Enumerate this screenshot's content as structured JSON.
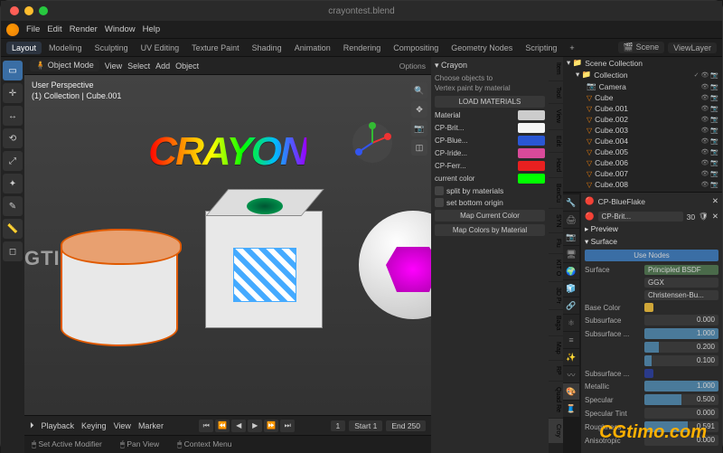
{
  "window": {
    "title": "crayontest.blend"
  },
  "menubar": [
    "File",
    "Edit",
    "Render",
    "Window",
    "Help"
  ],
  "workspaces": {
    "tabs": [
      "Layout",
      "Modeling",
      "Sculpting",
      "UV Editing",
      "Texture Paint",
      "Shading",
      "Animation",
      "Rendering",
      "Compositing",
      "Geometry Nodes",
      "Scripting",
      "+"
    ],
    "active": "Layout"
  },
  "topright": {
    "scene": "Scene",
    "viewlayer": "ViewLayer"
  },
  "vpheader": {
    "mode": "Object Mode",
    "menus": [
      "View",
      "Select",
      "Add",
      "Object"
    ],
    "options": "Options"
  },
  "viewport": {
    "perspective": "User Perspective",
    "collection_display": "(1) Collection | Cube.001",
    "text": "CRAYON"
  },
  "npanel": {
    "title": "Crayon",
    "subtitle": "Choose objects to",
    "sub2": "Vertex paint by material",
    "load_btn": "LOAD MATERIALS",
    "materials": [
      {
        "label": "Material",
        "color": "#cccccc"
      },
      {
        "label": "CP-Brit...",
        "color": "#f5f5f5"
      },
      {
        "label": "CP-Blue...",
        "color": "#2a57d4"
      },
      {
        "label": "CP-Iride...",
        "color": "#d94a9a"
      },
      {
        "label": "CP-Ferr...",
        "color": "#e82020"
      }
    ],
    "current_color_label": "current color",
    "current_color": "#00ff00",
    "check1": "split by materials",
    "check2": "set bottom origin",
    "btn1": "Map Current Color",
    "btn2": "Map Colors by Material",
    "tabs": [
      "Item",
      "Tool",
      "View",
      "Edit",
      "Hard",
      "BoxCu",
      "SYN",
      "Flu",
      "KIT O",
      "3D Pr",
      "Baga",
      "Map",
      "RP",
      "Quad Re",
      "Croy"
    ]
  },
  "outliner": {
    "root": "Scene Collection",
    "collection": "Collection",
    "items": [
      "Camera",
      "Cube",
      "Cube.001",
      "Cube.002",
      "Cube.003",
      "Cube.004",
      "Cube.005",
      "Cube.006",
      "Cube.007",
      "Cube.008"
    ]
  },
  "properties": {
    "material_name": "CP-BlueFlake",
    "slot_display": "CP-Brit...",
    "slot_meta": "30",
    "preview_label": "Preview",
    "surface_hdr": "Surface",
    "use_nodes": "Use Nodes",
    "surface": "Principled BSDF",
    "dist": "GGX",
    "sss": "Christensen-Bu...",
    "base_color_label": "Base Color",
    "base_color": "#cfa638",
    "params": [
      {
        "label": "Subsurface",
        "value": "0.000",
        "fill": 0
      },
      {
        "label": "Subsurface ...",
        "value": "1.000",
        "fill": 100
      },
      {
        "label": "",
        "value": "0.200",
        "fill": 20
      },
      {
        "label": "",
        "value": "0.100",
        "fill": 10
      }
    ],
    "subsurf_col_label": "Subsurface ...",
    "subsurf_color": "#2a3a8a",
    "sliders": [
      {
        "label": "Metallic",
        "value": "1.000",
        "fill": 100
      },
      {
        "label": "Specular",
        "value": "0.500",
        "fill": 50
      },
      {
        "label": "Specular Tint",
        "value": "0.000",
        "fill": 0
      },
      {
        "label": "Roughness",
        "value": "0.591",
        "fill": 59
      },
      {
        "label": "Anisotropic",
        "value": "0.000",
        "fill": 0
      }
    ]
  },
  "timeline": {
    "menus": [
      "Playback",
      "Keying",
      "View",
      "Marker"
    ],
    "frame": "1",
    "start_label": "Start",
    "start": "1",
    "end_label": "End",
    "end": "250"
  },
  "status": {
    "s1": "Set Active Modifier",
    "s2": "Pan View",
    "s3": "Context Menu"
  },
  "watermark_left": "GTIMO",
  "watermark_br": "CGtimo.com"
}
